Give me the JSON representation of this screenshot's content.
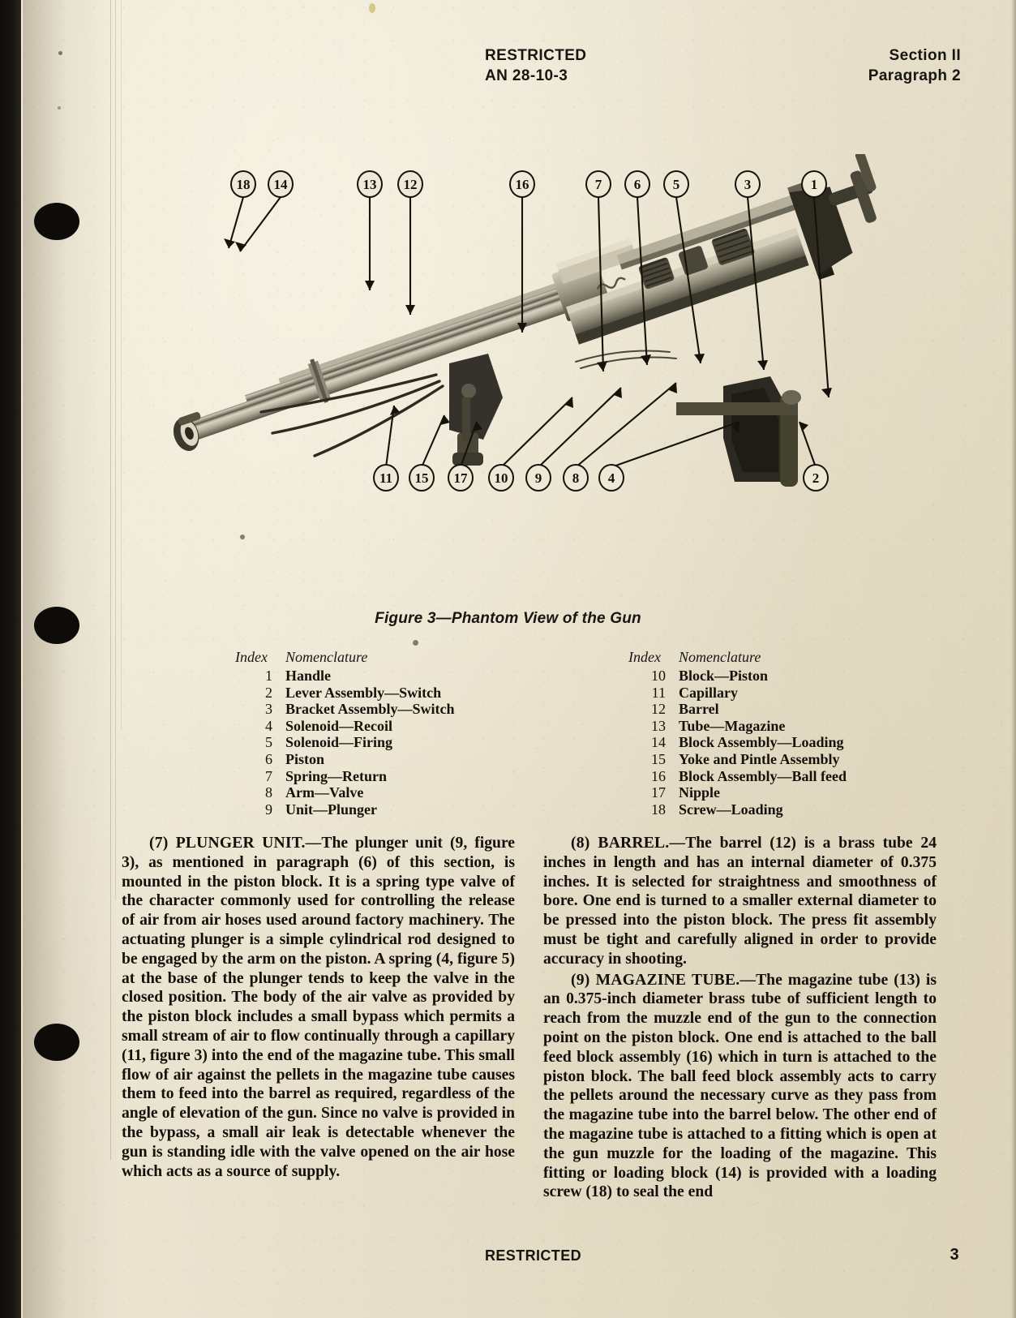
{
  "header": {
    "classification": "RESTRICTED",
    "document_number": "AN 28-10-3",
    "section": "Section II",
    "paragraph": "Paragraph 2"
  },
  "footer": {
    "classification": "RESTRICTED",
    "page_number": "3"
  },
  "figure": {
    "caption": "Figure 3—Phantom View of the Gun",
    "callouts_top": [
      "18",
      "14",
      "13",
      "12",
      "16",
      "7",
      "6",
      "5",
      "3",
      "1"
    ],
    "callouts_bottom": [
      "11",
      "15",
      "17",
      "10",
      "9",
      "8",
      "4",
      "2"
    ]
  },
  "index_table": {
    "column_headers": [
      "Index",
      "Nomenclature"
    ],
    "left": [
      {
        "index": "1",
        "nomenclature": "Handle"
      },
      {
        "index": "2",
        "nomenclature": "Lever Assembly—Switch"
      },
      {
        "index": "3",
        "nomenclature": "Bracket Assembly—Switch"
      },
      {
        "index": "4",
        "nomenclature": "Solenoid—Recoil"
      },
      {
        "index": "5",
        "nomenclature": "Solenoid—Firing"
      },
      {
        "index": "6",
        "nomenclature": "Piston"
      },
      {
        "index": "7",
        "nomenclature": "Spring—Return"
      },
      {
        "index": "8",
        "nomenclature": "Arm—Valve"
      },
      {
        "index": "9",
        "nomenclature": "Unit—Plunger"
      }
    ],
    "right": [
      {
        "index": "10",
        "nomenclature": "Block—Piston"
      },
      {
        "index": "11",
        "nomenclature": "Capillary"
      },
      {
        "index": "12",
        "nomenclature": "Barrel"
      },
      {
        "index": "13",
        "nomenclature": "Tube—Magazine"
      },
      {
        "index": "14",
        "nomenclature": "Block Assembly—Loading"
      },
      {
        "index": "15",
        "nomenclature": "Yoke and Pintle Assembly"
      },
      {
        "index": "16",
        "nomenclature": "Block Assembly—Ball feed"
      },
      {
        "index": "17",
        "nomenclature": "Nipple"
      },
      {
        "index": "18",
        "nomenclature": "Screw—Loading"
      }
    ]
  },
  "body": {
    "left_column": [
      {
        "run_in": "(7) PLUNGER UNIT.—",
        "text": "The plunger unit (9, fig­ure 3), as mentioned in paragraph (6) of this section, is mounted in the piston block. It is a spring type valve of the character commonly used for controlling the re­lease of air from air hoses used around factory ma­chinery. The actuating plunger is a simple cylindrical rod designed to be engaged by the arm on the piston. A spring (4, figure 5) at the base of the plunger tends to keep the valve in the closed position. The body of the air valve as provided by the piston block includes a small bypass which permits a small stream of air to flow continually through a capillary (11, figure 3) into the end of the magazine tube. This small flow of air against the pellets in the magazine tube causes them to feed into the barrel as required, regardless of the angle of elevation of the gun. Since no valve is pro­vided in the bypass, a small air leak is detectable when­ever the gun is standing idle with the valve opened on the air hose which acts as a source of supply."
      }
    ],
    "right_column": [
      {
        "run_in": "(8) BARREL.—",
        "text": "The barrel (12) is a brass tube 24 inches in length and has an internal diameter of 0.375 inches. It is selected for straightness and smoothness of bore. One end is turned to a smaller external diam­eter to be pressed into the piston block. The press fit assembly must be tight and carefully aligned in order to provide accuracy in shooting."
      },
      {
        "run_in": "(9) MAGAZINE TUBE.—",
        "text": "The magazine tube (13) is an 0.375-inch diameter brass tube of sufficient length to reach from the muzzle end of the gun to the connec­tion point on the piston block. One end is attached to the ball feed block assembly (16) which in turn is at­tached to the piston block. The ball feed block assembly acts to carry the pellets around the necessary curve as they pass from the magazine tube into the barrel below. The other end of the magazine tube is attached to a fitting which is open at the gun muzzle for the loading of the magazine. This fitting or loading block (14) is provided with a loading screw (18) to seal the end"
      }
    ]
  }
}
